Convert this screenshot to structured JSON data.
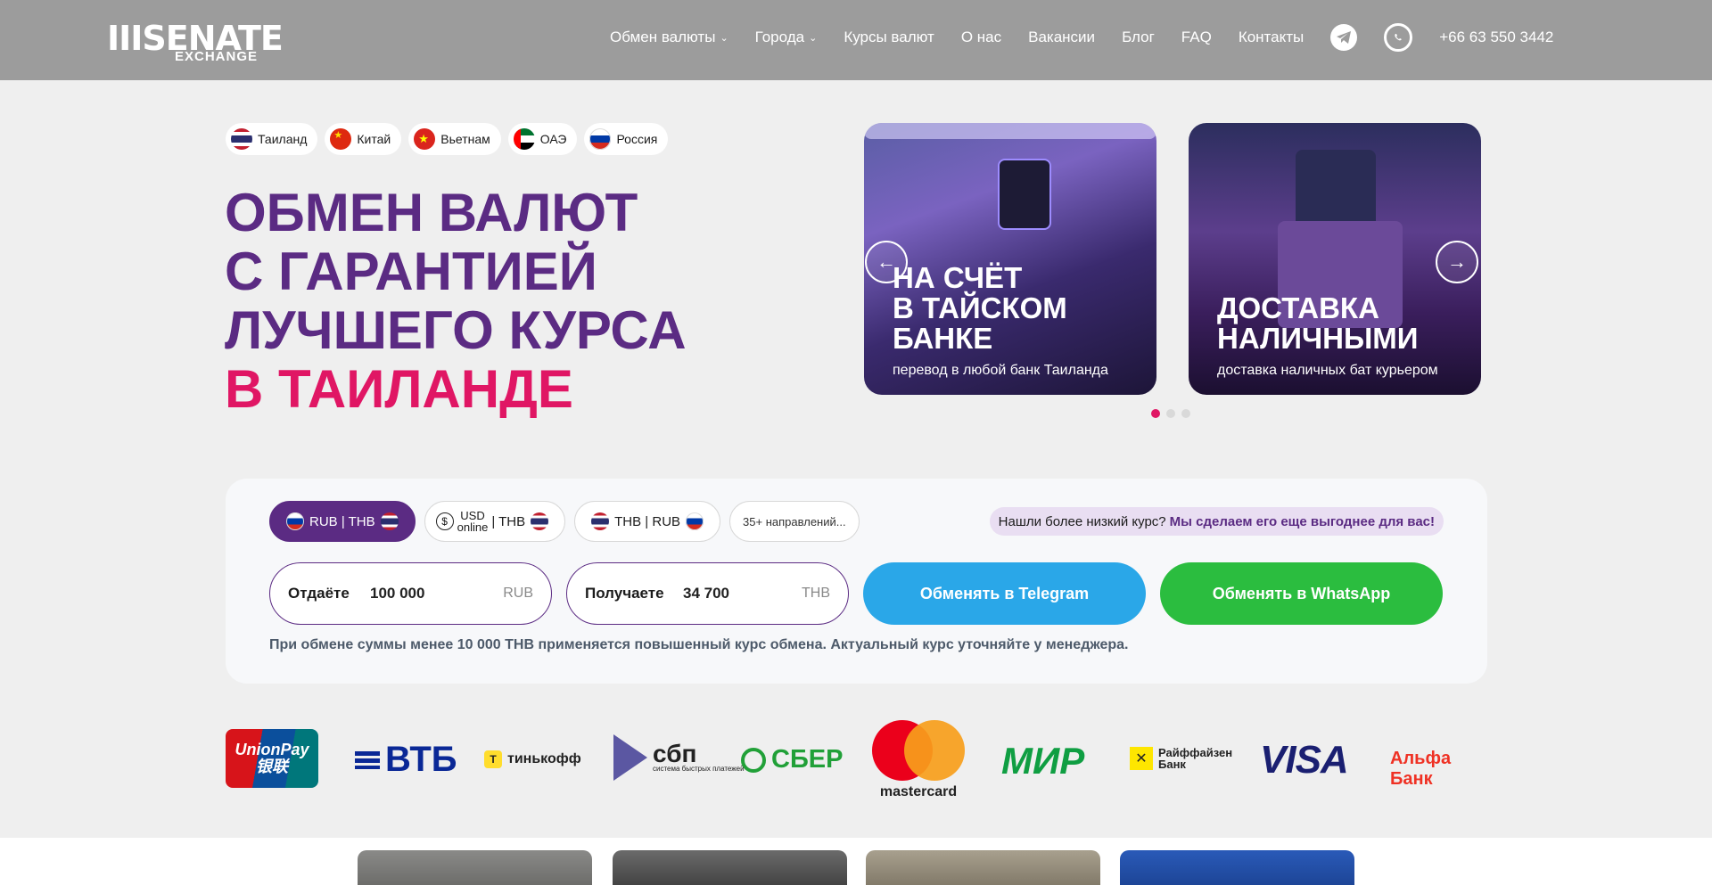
{
  "header": {
    "logo_brand": "IIISENATE",
    "logo_sub": "EXCHANGE",
    "nav": [
      {
        "label": "Обмен валюты",
        "dropdown": true
      },
      {
        "label": "Города",
        "dropdown": true
      },
      {
        "label": "Курсы валют",
        "dropdown": false
      },
      {
        "label": "О нас",
        "dropdown": false
      },
      {
        "label": "Вакансии",
        "dropdown": false
      },
      {
        "label": "Блог",
        "dropdown": false
      },
      {
        "label": "FAQ",
        "dropdown": false
      },
      {
        "label": "Контакты",
        "dropdown": false
      }
    ],
    "telegram_icon": "telegram-icon",
    "whatsapp_icon": "whatsapp-icon",
    "phone": "+66 63 550 3442"
  },
  "countries": [
    {
      "label": "Таиланд",
      "flag": "th"
    },
    {
      "label": "Китай",
      "flag": "cn"
    },
    {
      "label": "Вьетнам",
      "flag": "vn"
    },
    {
      "label": "ОАЭ",
      "flag": "ae"
    },
    {
      "label": "Россия",
      "flag": "ru"
    }
  ],
  "hero": {
    "line1": "ОБМЕН ВАЛЮТ",
    "line2": "С ГАРАНТИЕЙ",
    "line3": "ЛУЧШЕГО КУРСА",
    "line4": "В ТАИЛАНДЕ"
  },
  "slider": {
    "slides": [
      {
        "title_l1": "НА СЧЁТ",
        "title_l2": "В ТАЙСКОМ",
        "title_l3": "БАНКЕ",
        "subtitle": "перевод в любой банк Таиланда"
      },
      {
        "title_l1": "ДОСТАВКА",
        "title_l2": "НАЛИЧНЫМИ",
        "subtitle": "доставка наличных бат курьером"
      }
    ],
    "active_dot": 0,
    "dot_count": 3
  },
  "exchange": {
    "tabs": {
      "rub_thb": "RUB | THB",
      "usd_top": "USD",
      "usd_bottom": "online",
      "usd_pair": "| THB",
      "thb_rub": "THB | RUB",
      "more": "35+ направлений..."
    },
    "promo_text": "Нашли более низкий курс?",
    "promo_strong": "Мы сделаем его еще выгоднее для вас!",
    "give_label": "Отдаёте",
    "give_value": "100 000",
    "give_currency": "RUB",
    "get_label": "Получаете",
    "get_value": "34 700",
    "get_currency": "THB",
    "telegram_button": "Обменять в Telegram",
    "whatsapp_button": "Обменять в WhatsApp",
    "note": "При обмене суммы менее 10 000 THB применяется повышенный курс обмена. Актуальный курс уточняйте у менеджера."
  },
  "payments": {
    "unionpay_l1": "UnionPay",
    "unionpay_l2": "银联",
    "vtb": "ВТБ",
    "tinkoff": "тинькофф",
    "sbp": "сбп",
    "sbp_small": "система быстрых платежей",
    "sber": "СБЕР",
    "mastercard": "mastercard",
    "mir": "МИР",
    "raif_l1": "Райффайзен",
    "raif_l2": "Банк",
    "visa": "VISA",
    "alfa": "Альфа Банк"
  },
  "colors": {
    "primary": "#5b2b83",
    "accent": "#e01664",
    "telegram": "#2aa7e8",
    "whatsapp": "#2bbd3f",
    "header_bg": "#9c9c9c"
  }
}
